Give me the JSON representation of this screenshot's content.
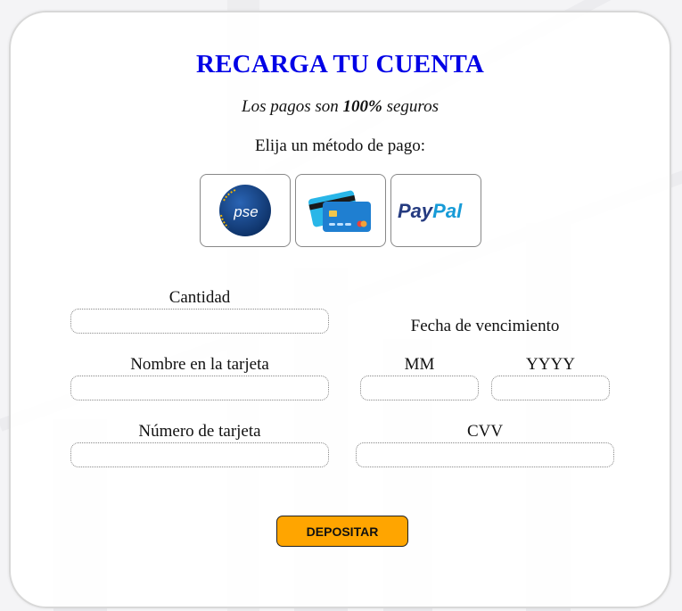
{
  "header": {
    "title": "RECARGA TU CUENTA",
    "subtitle_prefix": "Los pagos son ",
    "subtitle_bold": "100%",
    "subtitle_suffix": " seguros",
    "method_label": "Elija un método de pago:"
  },
  "payment_methods": [
    {
      "name": "pse",
      "logo_text": "pse",
      "icon": "pse-logo-icon"
    },
    {
      "name": "card",
      "icon": "credit-cards-icon"
    },
    {
      "name": "paypal",
      "logo_text_pay": "Pay",
      "logo_text_pal": "Pal",
      "icon": "paypal-logo-icon"
    }
  ],
  "form": {
    "amount_label": "Cantidad",
    "card_name_label": "Nombre en la tarjeta",
    "card_number_label": "Número de tarjeta",
    "expiry_label": "Fecha de vencimiento",
    "month_label": "MM",
    "year_label": "YYYY",
    "cvv_label": "CVV",
    "amount_value": "",
    "card_name_value": "",
    "card_number_value": "",
    "month_value": "",
    "year_value": "",
    "cvv_value": ""
  },
  "actions": {
    "deposit_label": "DEPOSITAR"
  },
  "colors": {
    "title": "#0000e6",
    "deposit_button": "#ffa500",
    "pse_blue": "#123f7c",
    "paypal_dark": "#253b80",
    "paypal_light": "#179bd7"
  }
}
